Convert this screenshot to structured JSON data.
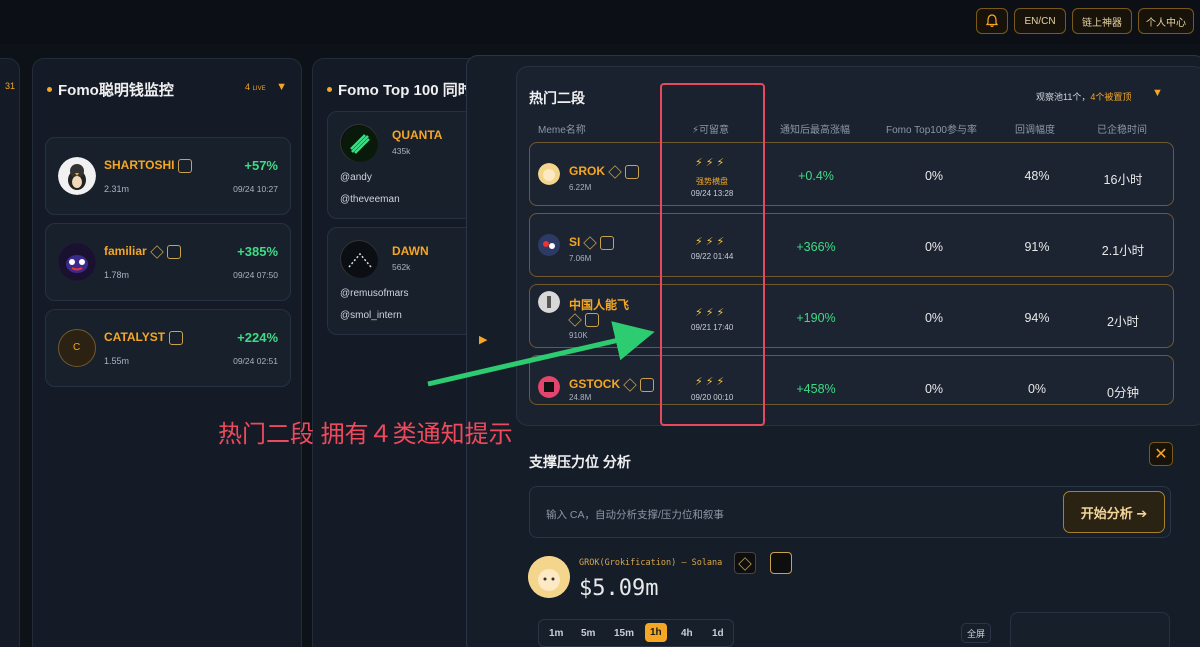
{
  "topbar": {
    "lang_label": "EN/CN",
    "chain_label": "链上神器",
    "user_center_label": "个人中心",
    "icons": [
      "bell-icon"
    ]
  },
  "left_strip": {
    "number": "31"
  },
  "smart_money": {
    "title": "Fomo聪明钱监控",
    "live_count": "4",
    "live_label": "LIVE",
    "coins": [
      {
        "name": "SHARTOSHI",
        "sub": "2.31m",
        "pct": "+57%",
        "time": "09/24 10:27"
      },
      {
        "name": "familiar",
        "sub": "1.78m",
        "pct": "+385%",
        "time": "09/24 07:50"
      },
      {
        "name": "CATALYST",
        "sub": "1.55m",
        "pct": "+224%",
        "time": "09/24 02:51",
        "avatar_letter": "C"
      }
    ]
  },
  "top100": {
    "title": "Fomo Top 100 同时",
    "cards": [
      {
        "name": "QUANTA",
        "sub": "435k",
        "handles": [
          "@andy",
          "@theveeman"
        ]
      },
      {
        "name": "DAWN",
        "sub": "562k",
        "handles": [
          "@remusofmars",
          "@smol_intern"
        ]
      }
    ]
  },
  "hot": {
    "title": "热门二段",
    "meta_prefix": "观察池11个，",
    "meta_highlight": "4个被置顶",
    "columns": [
      "Meme名称",
      "⚡可留意",
      "通知后最高涨幅",
      "Fomo Top100参与率",
      "回调幅度",
      "已企稳时间"
    ],
    "rows": [
      {
        "name": "GROK",
        "sub": "6.22M",
        "bolts": "⚡⚡⚡",
        "tag": "强势横盘",
        "date": "09/24 13:28",
        "gain": "+0.4%",
        "participation": "0%",
        "pullback": "48%",
        "stable": "16小时"
      },
      {
        "name": "SI",
        "sub": "7.06M",
        "bolts": "⚡⚡⚡",
        "tag": "",
        "date": "09/22 01:44",
        "gain": "+366%",
        "participation": "0%",
        "pullback": "91%",
        "stable": "2.1小时"
      },
      {
        "name": "中国人能飞",
        "sub": "910K",
        "bolts": "⚡⚡⚡",
        "tag": "",
        "date": "09/21 17:40",
        "gain": "+190%",
        "participation": "0%",
        "pullback": "94%",
        "stable": "2小时"
      },
      {
        "name": "GSTOCK",
        "sub": "24.8M",
        "bolts": "⚡⚡⚡",
        "tag": "",
        "date": "09/20 00:10",
        "gain": "+458%",
        "participation": "0%",
        "pullback": "0%",
        "stable": "0分钟"
      }
    ]
  },
  "annotation": "热门二段 拥有４类通知提示",
  "support": {
    "title": "支撑压力位 分析",
    "placeholder": "输入 CA，自动分析支撑/压力位和叙事",
    "button": "开始分析 ➔",
    "token_label": "GROK(Grokification) – Solana",
    "price": "$5.09m",
    "timeframes": [
      "1m",
      "5m",
      "15m",
      "1h",
      "4h",
      "1d"
    ],
    "active_timeframe": "1h",
    "fullscreen": "全屏"
  }
}
